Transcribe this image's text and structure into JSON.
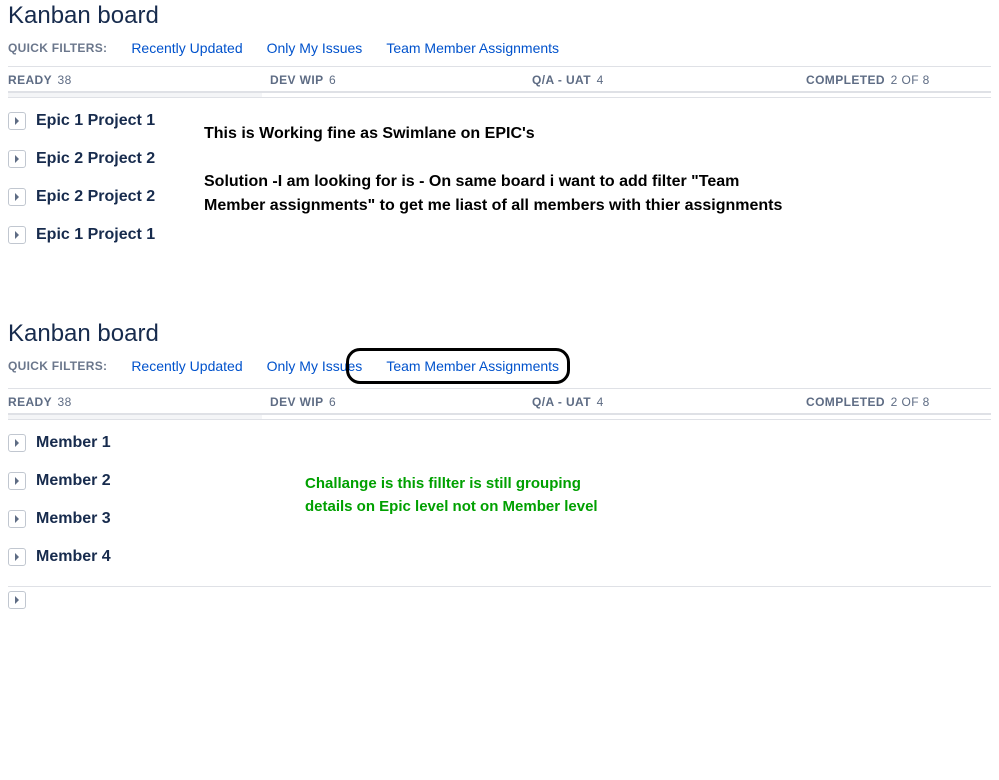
{
  "board1": {
    "title": "Kanban board",
    "filters_label": "QUICK FILTERS:",
    "filters": [
      "Recently Updated",
      "Only My Issues",
      "Team Member Assignments"
    ],
    "columns": [
      {
        "name": "READY",
        "count": "38"
      },
      {
        "name": "DEV WIP",
        "count": "6"
      },
      {
        "name": "Q/A - UAT",
        "count": "4"
      },
      {
        "name": "COMPLETED",
        "count": "2 OF 8"
      }
    ],
    "swimlanes": [
      "Epic 1 Project 1",
      "Epic 2 Project 2",
      "Epic 2 Project 2",
      "Epic 1 Project 1"
    ],
    "note1": "This is Working fine as Swimlane on EPIC's",
    "note2": "Solution -I  am looking for is  - On same board i want to add filter \"Team Member assignments\" to get me liast of all members with thier assignments"
  },
  "board2": {
    "title": "Kanban board",
    "filters_label": "QUICK FILTERS:",
    "filters": [
      "Recently Updated",
      "Only My Issues",
      "Team Member Assignments"
    ],
    "columns": [
      {
        "name": "READY",
        "count": "38"
      },
      {
        "name": "DEV WIP",
        "count": "6"
      },
      {
        "name": "Q/A - UAT",
        "count": "4"
      },
      {
        "name": "COMPLETED",
        "count": "2 OF 8"
      }
    ],
    "swimlanes": [
      "Member 1",
      "Member 2",
      "Member 3",
      "Member 4"
    ],
    "note": "Challange is this fillter is still grouping details on Epic level not on Member level"
  }
}
